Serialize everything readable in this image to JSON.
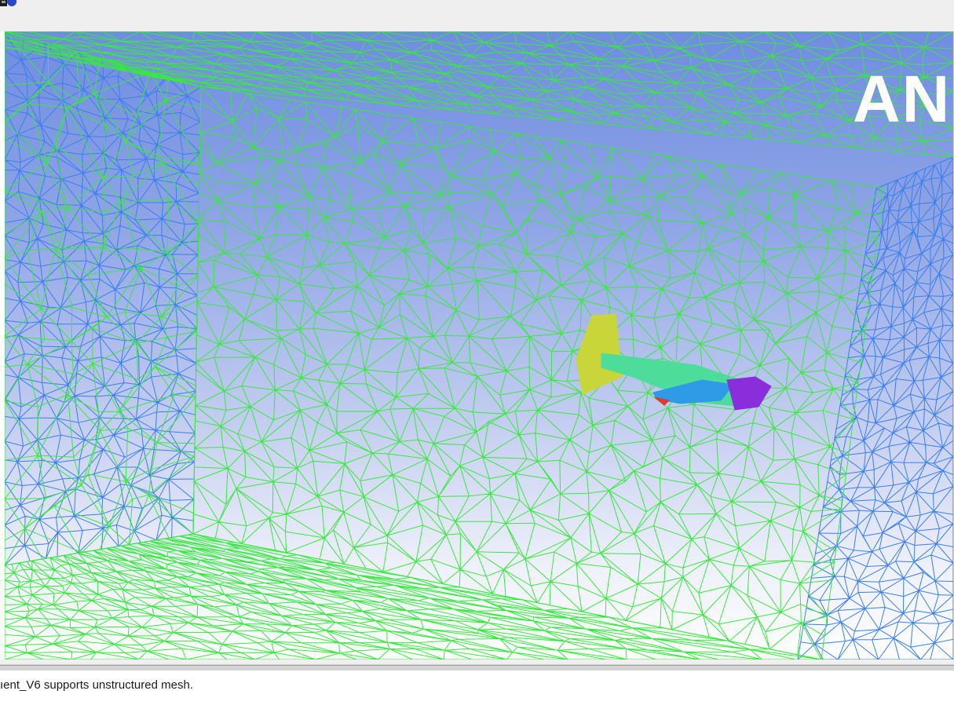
{
  "toolbar": {
    "save_icon": "floppy-disk-icon"
  },
  "viewport": {
    "logo_text": "AN",
    "colors": {
      "domain_mesh": "#39e83f",
      "wall_mesh": "#3a7ef0",
      "background_top": "#6f8ce0",
      "background_bottom": "#ffffff",
      "tail": "#c9d63a",
      "fuselage": "#4ddc9a",
      "wing": "#2f9be6",
      "nose": "#8a2ddb",
      "wingtip": "#e53535"
    }
  },
  "console": {
    "message": "ıent_V6 supports unstructured mesh."
  }
}
